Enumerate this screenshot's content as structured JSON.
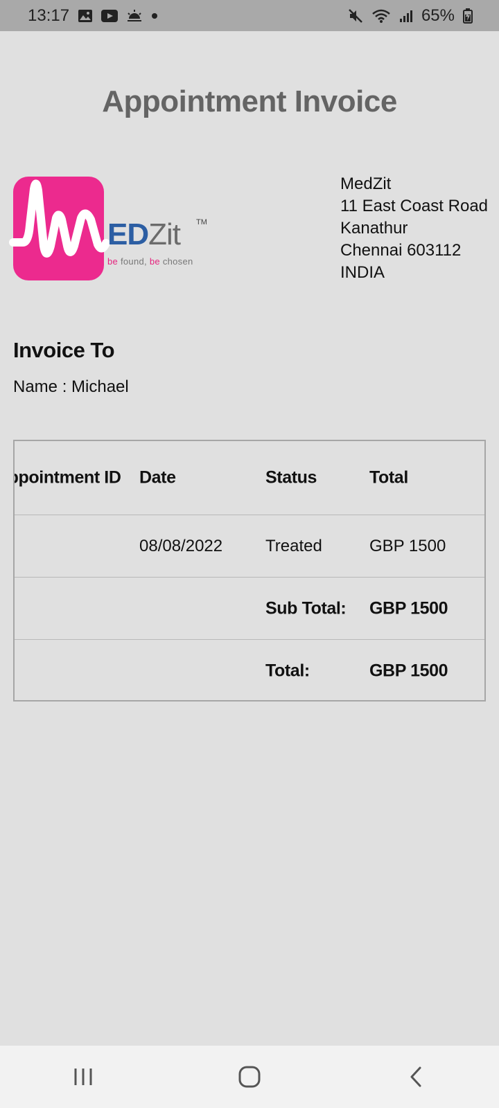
{
  "status_bar": {
    "time": "13:17",
    "left_icons": [
      "gallery-icon",
      "youtube-icon",
      "weather-icon",
      "dot-icon"
    ],
    "right_icons": [
      "mute-icon",
      "wifi-icon",
      "signal-icon",
      "battery-icon"
    ],
    "battery": "65%"
  },
  "page": {
    "title": "Appointment Invoice"
  },
  "logo": {
    "wordmark_ed": "ED",
    "wordmark_zit": "Zit",
    "trademark": "TM",
    "tagline_1": "be",
    "tagline_2": " found, ",
    "tagline_3": "be",
    "tagline_4": " chosen"
  },
  "company": {
    "name": "MedZit",
    "street": "11 East Coast Road",
    "area": "Kanathur",
    "city": "Chennai 603112",
    "country": "INDIA"
  },
  "invoice_to": {
    "heading": "Invoice To",
    "name_line": "Name : Michael"
  },
  "table": {
    "headers": {
      "appointment_id": "Appointment ID",
      "date": "Date",
      "status": "Status",
      "total": "Total"
    },
    "row": {
      "appointment_id": "",
      "date": "08/08/2022",
      "status": "Treated",
      "total": "GBP 1500"
    },
    "subtotal": {
      "label": "Sub Total:",
      "value": "GBP 1500"
    },
    "grand_total": {
      "label": "Total:",
      "value": "GBP 1500"
    }
  },
  "nav": {
    "buttons": [
      "recent-apps-icon",
      "home-icon",
      "back-icon"
    ]
  },
  "colors": {
    "background": "#e0e0e0",
    "status_bar": "#a9a9a9",
    "title": "#646464",
    "logo_pink": "#ec2a8e",
    "logo_blue": "#2c5ea3",
    "table_border": "#a6a6a6"
  }
}
